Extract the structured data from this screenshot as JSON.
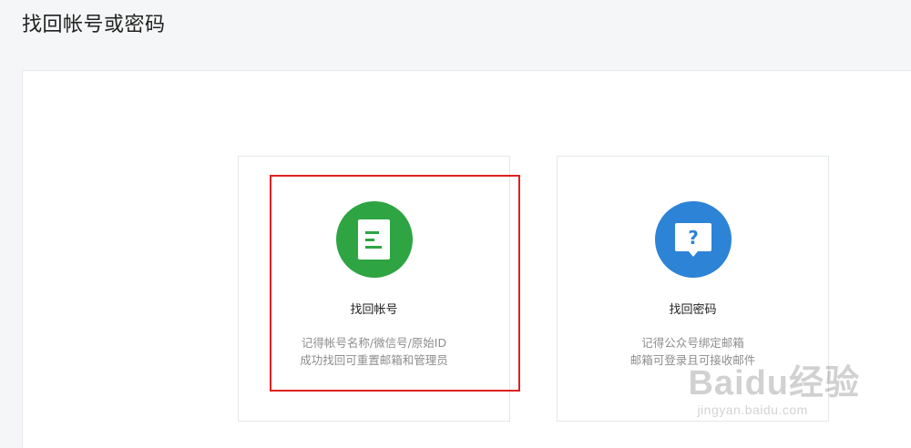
{
  "page": {
    "title": "找回帐号或密码"
  },
  "cards": [
    {
      "title": "找回帐号",
      "desc_line1": "记得帐号名称/微信号/原始ID",
      "desc_line2": "成功找回可重置邮箱和管理员",
      "icon": "document-icon",
      "color": "#2ea443"
    },
    {
      "title": "找回密码",
      "desc_line1": "记得公众号绑定邮箱",
      "desc_line2": "邮箱可登录且可接收邮件",
      "icon": "question-bubble-icon",
      "color": "#2d83d6"
    }
  ],
  "highlight": {
    "color": "#e02020"
  },
  "watermark": {
    "brand": "Baidu经验",
    "site": "jingyan.baidu.com"
  }
}
